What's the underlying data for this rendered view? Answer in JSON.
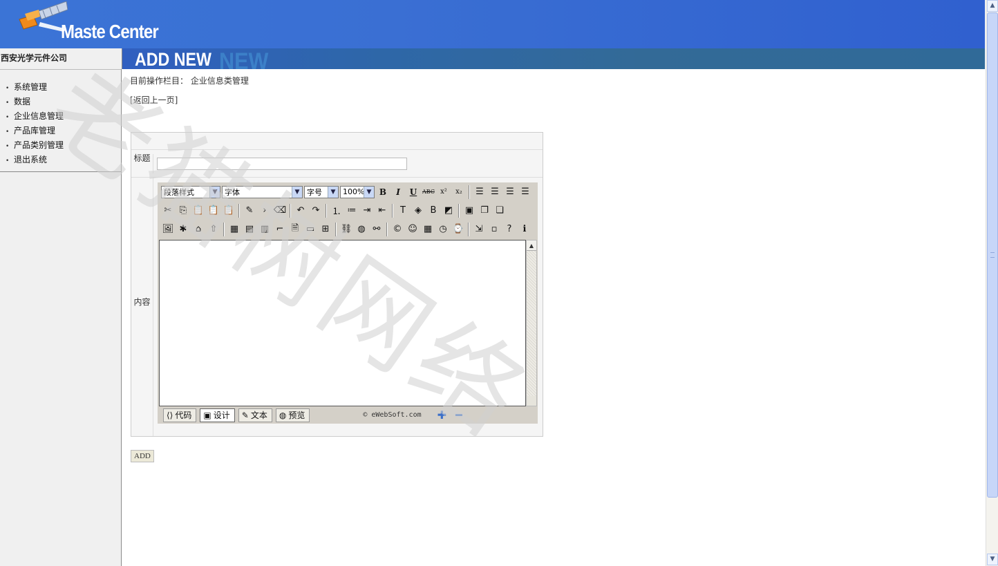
{
  "header": {
    "app_title": "Maste Center",
    "company": "西安光学元件公司",
    "section": "ADD NEW",
    "section_ghost": "NEW"
  },
  "sidebar": {
    "items": [
      {
        "label": "系统管理"
      },
      {
        "label": "数据"
      },
      {
        "label": "企业信息管理"
      },
      {
        "label": "产品库管理"
      },
      {
        "label": "产品类别管理"
      },
      {
        "label": "退出系统"
      }
    ]
  },
  "main": {
    "breadcrumb": "目前操作栏目： 企业信息类管理",
    "back_link": "[返回上一页]",
    "form": {
      "title_label": "标题",
      "title_value": "",
      "content_label": "内容"
    },
    "submit_label": "ADD"
  },
  "editor": {
    "paragraph_select": "段落样式",
    "font_select": "字体",
    "size_select": "字号",
    "zoom_select": "100%",
    "modes": [
      {
        "label": "代码",
        "icon": "code-icon"
      },
      {
        "label": "设计",
        "icon": "design-icon"
      },
      {
        "label": "文本",
        "icon": "text-icon"
      },
      {
        "label": "预览",
        "icon": "preview-icon"
      }
    ],
    "credit": "© eWebSoft.com"
  },
  "watermark": "老猫树网络",
  "colors": {
    "header_blue": "#3a6fd3",
    "strip_blue": "#306a98",
    "sidebar_bg": "#f0f0f0",
    "editor_chrome": "#d4d0c8"
  }
}
